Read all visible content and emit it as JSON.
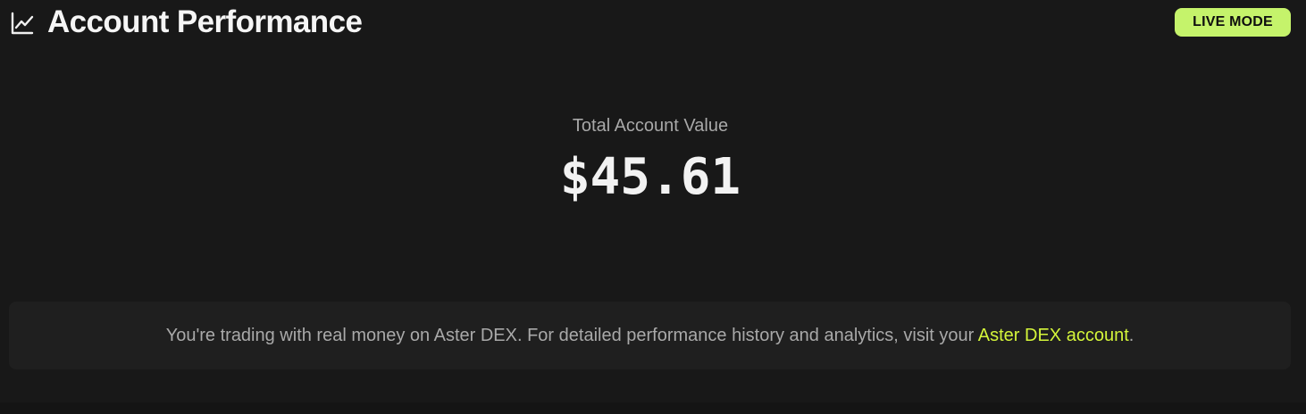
{
  "header": {
    "icon": "line-chart-icon",
    "title": "Account Performance"
  },
  "badge": {
    "label": "LIVE MODE",
    "color": "#c5f36b"
  },
  "account": {
    "label": "Total Account Value",
    "value": "$45.61"
  },
  "notice": {
    "text": "You're trading with real money on Aster DEX. For detailed performance history and analytics, visit your ",
    "link_text": "Aster DEX account",
    "suffix": ".",
    "link_color": "#d4f53a"
  }
}
